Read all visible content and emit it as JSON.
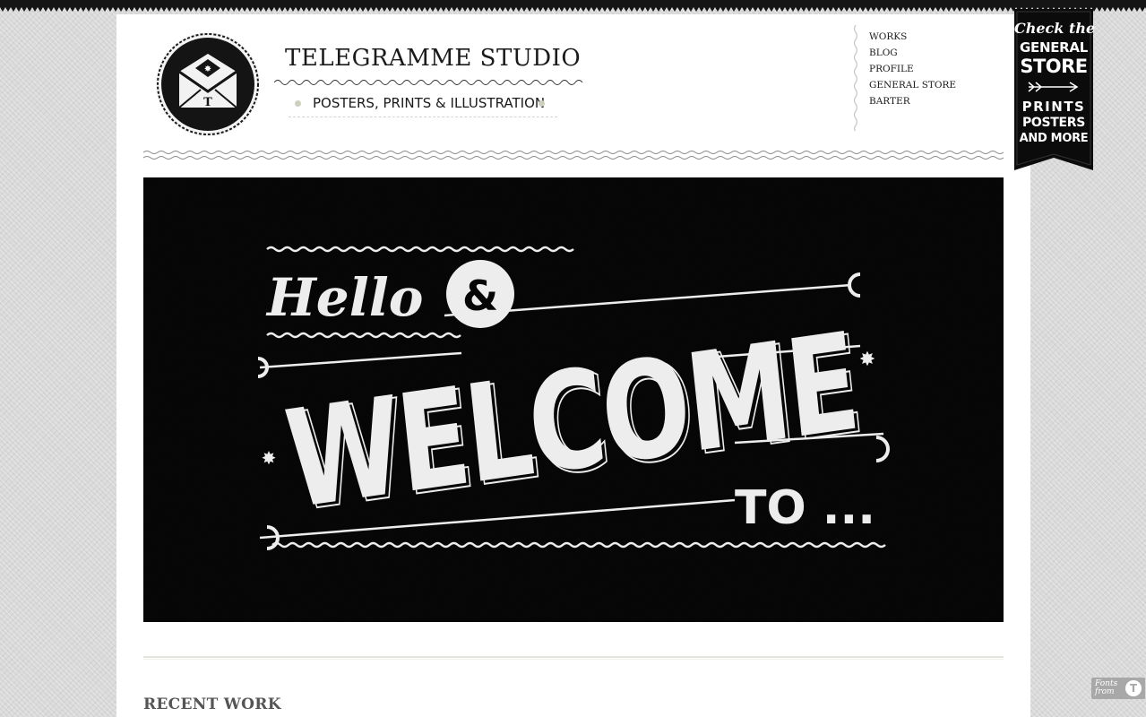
{
  "brand": {
    "title": "TELEGRAMME STUDIO",
    "tagline": "POSTERS, PRINTS & ILLUSTRATION",
    "logo_letter": "T"
  },
  "nav": {
    "items": [
      {
        "label": "WORKS"
      },
      {
        "label": "BLOG"
      },
      {
        "label": "PROFILE"
      },
      {
        "label": "GENERAL STORE"
      },
      {
        "label": "BARTER"
      }
    ]
  },
  "hero": {
    "line1": "Hello",
    "ampersand": "&",
    "line2": "WELCOME",
    "line3": "TO ..."
  },
  "store_ribbon": {
    "line1": "Check the",
    "line2": "GENERAL",
    "line3": "STORE",
    "line4": "PRINTS",
    "line5": "POSTERS",
    "line6": "AND MORE"
  },
  "sections": {
    "recent_work_title": "RECENT WORK"
  },
  "fonts_badge": {
    "label": "Fonts from",
    "icon_letter": "T"
  },
  "colors": {
    "background": "#d9d9d9",
    "page": "#ffffff",
    "ink": "#1a1a1a",
    "hero": "#060606"
  }
}
